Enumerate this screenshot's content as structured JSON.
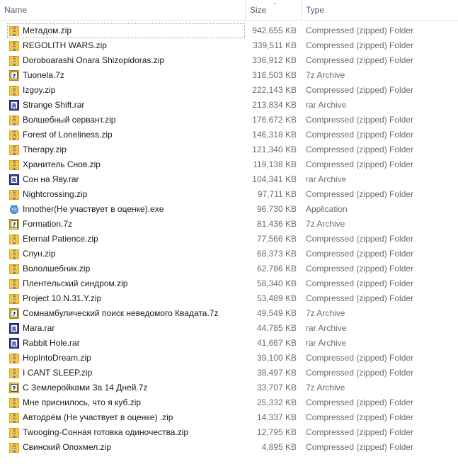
{
  "columns": {
    "name": "Name",
    "size": "Size",
    "type": "Type"
  },
  "files": [
    {
      "name": "Метадом.zip",
      "size": "942,655 KB",
      "type": "Compressed (zipped) Folder",
      "icon": "zip-folder-icon"
    },
    {
      "name": "REGOLITH WARS.zip",
      "size": "339,511 KB",
      "type": "Compressed (zipped) Folder",
      "icon": "zip-folder-icon"
    },
    {
      "name": "Doroboarashi Onara Shizopidoras.zip",
      "size": "336,912 KB",
      "type": "Compressed (zipped) Folder",
      "icon": "zip-folder-icon"
    },
    {
      "name": "Tuonela.7z",
      "size": "316,503 KB",
      "type": "7z Archive",
      "icon": "7z-archive-icon"
    },
    {
      "name": "Izgoy.zip",
      "size": "222,143 KB",
      "type": "Compressed (zipped) Folder",
      "icon": "zip-folder-icon"
    },
    {
      "name": "Strange Shift.rar",
      "size": "213,834 KB",
      "type": "rar Archive",
      "icon": "rar-archive-icon"
    },
    {
      "name": "Волшебный сервант.zip",
      "size": "176,672 KB",
      "type": "Compressed (zipped) Folder",
      "icon": "zip-folder-icon"
    },
    {
      "name": "Forest of Loneliness.zip",
      "size": "146,318 KB",
      "type": "Compressed (zipped) Folder",
      "icon": "zip-folder-icon"
    },
    {
      "name": "Therapy.zip",
      "size": "121,340 KB",
      "type": "Compressed (zipped) Folder",
      "icon": "zip-folder-icon"
    },
    {
      "name": "Хранитель Снов.zip",
      "size": "119,138 KB",
      "type": "Compressed (zipped) Folder",
      "icon": "zip-folder-icon"
    },
    {
      "name": "Сон на Яву.rar",
      "size": "104,341 KB",
      "type": "rar Archive",
      "icon": "rar-archive-icon"
    },
    {
      "name": "Nightcrossing.zip",
      "size": "97,711 KB",
      "type": "Compressed (zipped) Folder",
      "icon": "zip-folder-icon"
    },
    {
      "name": "Innother(Не участвует в оценке).exe",
      "size": "96,730 KB",
      "type": "Application",
      "icon": "application-icon"
    },
    {
      "name": "Formation.7z",
      "size": "81,436 KB",
      "type": "7z Archive",
      "icon": "7z-archive-icon"
    },
    {
      "name": "Eternal Patience.zip",
      "size": "77,566 KB",
      "type": "Compressed (zipped) Folder",
      "icon": "zip-folder-icon"
    },
    {
      "name": "Спун.zip",
      "size": "68,373 KB",
      "type": "Compressed (zipped) Folder",
      "icon": "zip-folder-icon"
    },
    {
      "name": "Вололшебник.zip",
      "size": "62,786 KB",
      "type": "Compressed (zipped) Folder",
      "icon": "zip-folder-icon"
    },
    {
      "name": "Плентельский синдром.zip",
      "size": "58,340 KB",
      "type": "Compressed (zipped) Folder",
      "icon": "zip-folder-icon"
    },
    {
      "name": "Project 10.N.31.Y.zip",
      "size": "53,489 KB",
      "type": "Compressed (zipped) Folder",
      "icon": "zip-folder-icon"
    },
    {
      "name": "Сомнамбулический поиск неведомого Квадата.7z",
      "size": "49,549 KB",
      "type": "7z Archive",
      "icon": "7z-archive-icon"
    },
    {
      "name": "Mara.rar",
      "size": "44,785 KB",
      "type": "rar Archive",
      "icon": "rar-archive-icon"
    },
    {
      "name": "Rabbit Hole.rar",
      "size": "41,667 KB",
      "type": "rar Archive",
      "icon": "rar-archive-icon"
    },
    {
      "name": "HopIntoDream.zip",
      "size": "39,100 KB",
      "type": "Compressed (zipped) Folder",
      "icon": "zip-folder-icon"
    },
    {
      "name": "I CANT SLEEP.zip",
      "size": "38,497 KB",
      "type": "Compressed (zipped) Folder",
      "icon": "zip-folder-icon"
    },
    {
      "name": "С Землеройками За 14 Дней.7z",
      "size": "33,707 KB",
      "type": "7z Archive",
      "icon": "7z-archive-icon"
    },
    {
      "name": "Мне приснилось, что я куб.zip",
      "size": "25,332 KB",
      "type": "Compressed (zipped) Folder",
      "icon": "zip-folder-icon"
    },
    {
      "name": "Автодрём (Не участвует в оценке) .zip",
      "size": "14,337 KB",
      "type": "Compressed (zipped) Folder",
      "icon": "zip-folder-icon"
    },
    {
      "name": "Twooging-Сонная готовка одиночества.zip",
      "size": "12,795 KB",
      "type": "Compressed (zipped) Folder",
      "icon": "zip-folder-icon"
    },
    {
      "name": "Свинский Опохмел.zip",
      "size": "4,895 KB",
      "type": "Compressed (zipped) Folder",
      "icon": "zip-folder-icon"
    }
  ],
  "colors": {
    "header_text": "#4c607a",
    "secondary_text": "#6d6d6d",
    "zip_yellow": "#f4c430",
    "rar_blue": "#2b3a9c"
  }
}
